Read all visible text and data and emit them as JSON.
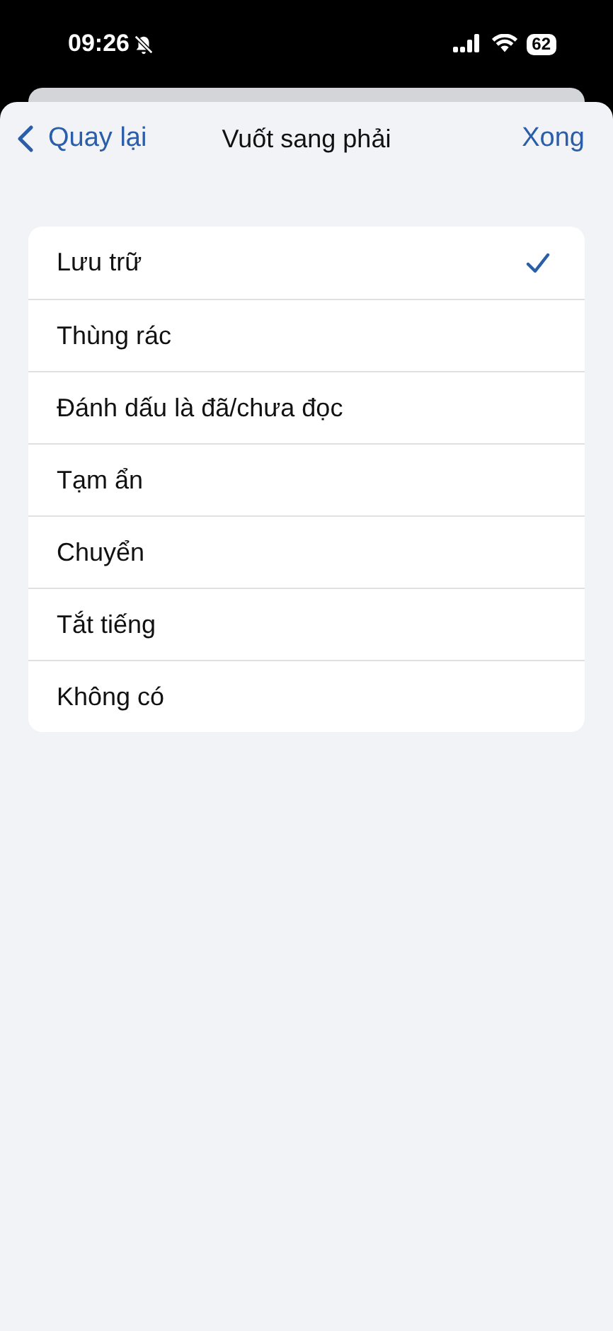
{
  "status_bar": {
    "time": "09:26",
    "battery": "62"
  },
  "nav": {
    "back": "Quay lại",
    "title": "Vuốt sang phải",
    "done": "Xong"
  },
  "options": [
    {
      "label": "Lưu trữ",
      "selected": true
    },
    {
      "label": "Thùng rác",
      "selected": false
    },
    {
      "label": "Đánh dấu là đã/chưa đọc",
      "selected": false
    },
    {
      "label": "Tạm ẩn",
      "selected": false
    },
    {
      "label": "Chuyển",
      "selected": false
    },
    {
      "label": "Tắt tiếng",
      "selected": false
    },
    {
      "label": "Không có",
      "selected": false
    }
  ]
}
